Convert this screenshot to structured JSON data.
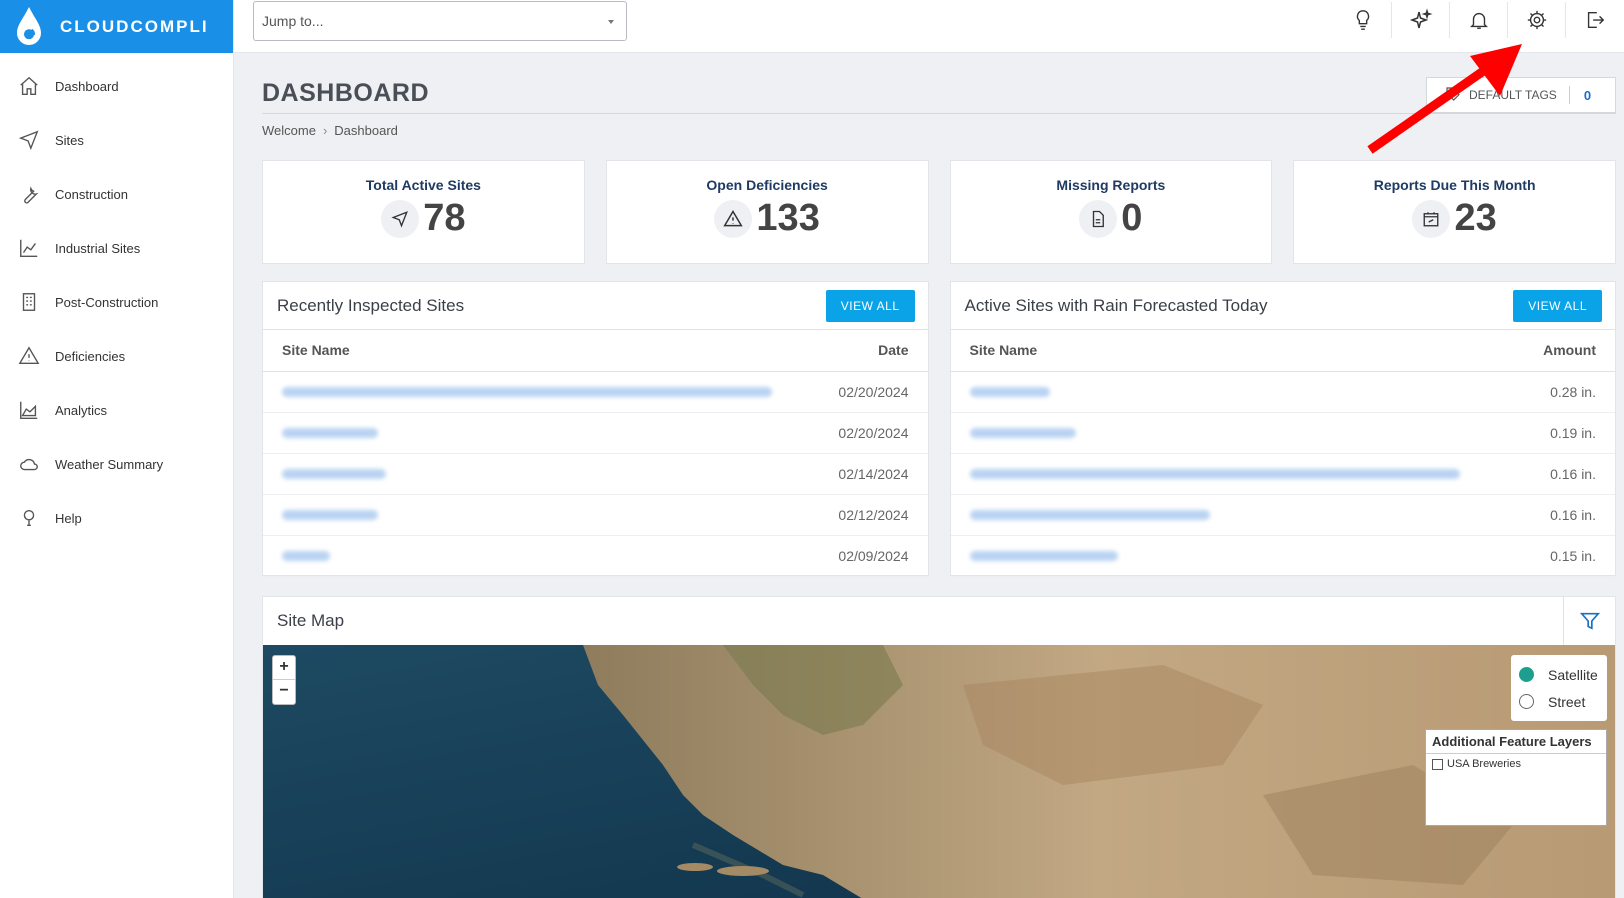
{
  "brand": {
    "name": "CLOUDCOMPLI"
  },
  "search": {
    "placeholder": "Jump to..."
  },
  "topbar": {
    "icons": [
      "lightbulb-icon",
      "sparkle-icon",
      "bell-icon",
      "gear-icon",
      "logout-icon"
    ]
  },
  "sidebar": {
    "items": [
      {
        "label": "Dashboard",
        "icon": "home-icon"
      },
      {
        "label": "Sites",
        "icon": "navigation-icon"
      },
      {
        "label": "Construction",
        "icon": "wrench-icon"
      },
      {
        "label": "Industrial Sites",
        "icon": "industry-chart-icon"
      },
      {
        "label": "Post-Construction",
        "icon": "building-icon"
      },
      {
        "label": "Deficiencies",
        "icon": "warning-icon"
      },
      {
        "label": "Analytics",
        "icon": "area-chart-icon"
      },
      {
        "label": "Weather Summary",
        "icon": "cloud-icon"
      },
      {
        "label": "Help",
        "icon": "help-icon"
      }
    ]
  },
  "page": {
    "title": "DASHBOARD",
    "breadcrumb": [
      "Welcome",
      "Dashboard"
    ],
    "tags_label": "DEFAULT TAGS",
    "tags_count": "0"
  },
  "stats": [
    {
      "label": "Total Active Sites",
      "value": "78",
      "icon": "navigation-icon"
    },
    {
      "label": "Open Deficiencies",
      "value": "133",
      "icon": "warning-icon"
    },
    {
      "label": "Missing Reports",
      "value": "0",
      "icon": "document-icon"
    },
    {
      "label": "Reports Due This Month",
      "value": "23",
      "icon": "calendar-icon"
    }
  ],
  "recent": {
    "title": "Recently Inspected Sites",
    "button": "VIEW ALL",
    "col_name": "Site Name",
    "col_date": "Date",
    "dates": [
      "02/20/2024",
      "02/20/2024",
      "02/14/2024",
      "02/12/2024",
      "02/09/2024"
    ]
  },
  "rain": {
    "title": "Active Sites with Rain Forecasted Today",
    "button": "VIEW ALL",
    "col_name": "Site Name",
    "col_amount": "Amount",
    "amounts": [
      "0.28 in.",
      "0.19 in.",
      "0.16 in.",
      "0.16 in.",
      "0.15 in."
    ]
  },
  "map": {
    "title": "Site Map",
    "zoom_in": "+",
    "zoom_out": "−",
    "basemaps": [
      "Satellite",
      "Street"
    ],
    "selected_basemap": "Satellite",
    "layers_title": "Additional Feature Layers",
    "layers": [
      "USA Breweries"
    ]
  },
  "colors": {
    "brand": "#1a8fe8",
    "button": "#0aa3e8",
    "annotation": "#ff0000"
  }
}
